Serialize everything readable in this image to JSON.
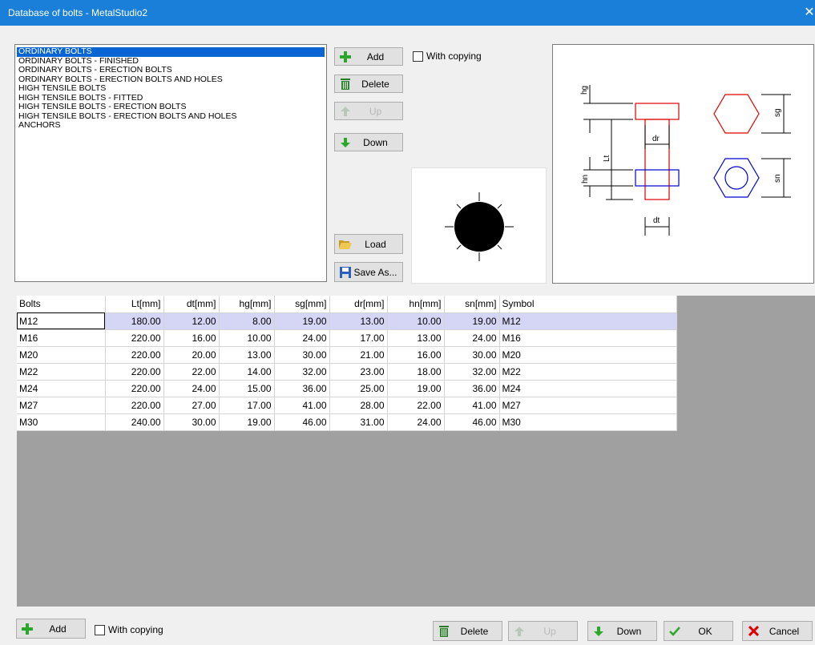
{
  "window": {
    "title": "Database of bolts - MetalStudio2",
    "close_glyph": "✕"
  },
  "groups": [
    "ORDINARY BOLTS",
    "ORDINARY BOLTS - FINISHED",
    "ORDINARY BOLTS - ERECTION BOLTS",
    "ORDINARY BOLTS - ERECTION BOLTS AND HOLES",
    "HIGH TENSILE BOLTS",
    "HIGH TENSILE BOLTS - FITTED",
    "HIGH TENSILE BOLTS - ERECTION BOLTS",
    "HIGH TENSILE BOLTS - ERECTION BOLTS AND HOLES",
    "ANCHORS"
  ],
  "group_actions": {
    "add": "Add",
    "delete": "Delete",
    "up": "Up",
    "down": "Down",
    "load": "Load",
    "save_as": "Save As...",
    "with_copying": "With copying"
  },
  "drawing": {
    "hg": "hg",
    "sg": "sg",
    "dr": "dr",
    "lt": "Lt",
    "hn": "hn",
    "sn": "sn",
    "dt": "dt"
  },
  "table": {
    "columns": [
      "Bolts",
      "Lt[mm]",
      "dt[mm]",
      "hg[mm]",
      "sg[mm]",
      "dr[mm]",
      "hn[mm]",
      "sn[mm]",
      "Symbol"
    ],
    "rows": [
      [
        "M12",
        "180.00",
        "12.00",
        "8.00",
        "19.00",
        "13.00",
        "10.00",
        "19.00",
        "M12"
      ],
      [
        "M16",
        "220.00",
        "16.00",
        "10.00",
        "24.00",
        "17.00",
        "13.00",
        "24.00",
        "M16"
      ],
      [
        "M20",
        "220.00",
        "20.00",
        "13.00",
        "30.00",
        "21.00",
        "16.00",
        "30.00",
        "M20"
      ],
      [
        "M22",
        "220.00",
        "22.00",
        "14.00",
        "32.00",
        "23.00",
        "18.00",
        "32.00",
        "M22"
      ],
      [
        "M24",
        "220.00",
        "24.00",
        "15.00",
        "36.00",
        "25.00",
        "19.00",
        "36.00",
        "M24"
      ],
      [
        "M27",
        "220.00",
        "27.00",
        "17.00",
        "41.00",
        "28.00",
        "22.00",
        "41.00",
        "M27"
      ],
      [
        "M30",
        "240.00",
        "30.00",
        "19.00",
        "46.00",
        "31.00",
        "24.00",
        "46.00",
        "M30"
      ]
    ]
  },
  "bottom": {
    "add": "Add",
    "with_copying": "With copying",
    "delete": "Delete",
    "up": "Up",
    "down": "Down",
    "ok": "OK",
    "cancel": "Cancel"
  },
  "colors": {
    "titlebar": "#1a7fd8",
    "selection": "#0a65d4",
    "bolt_head": "#e00000",
    "bolt_nut": "#0000d0",
    "add_icon": "#2aa82a"
  }
}
